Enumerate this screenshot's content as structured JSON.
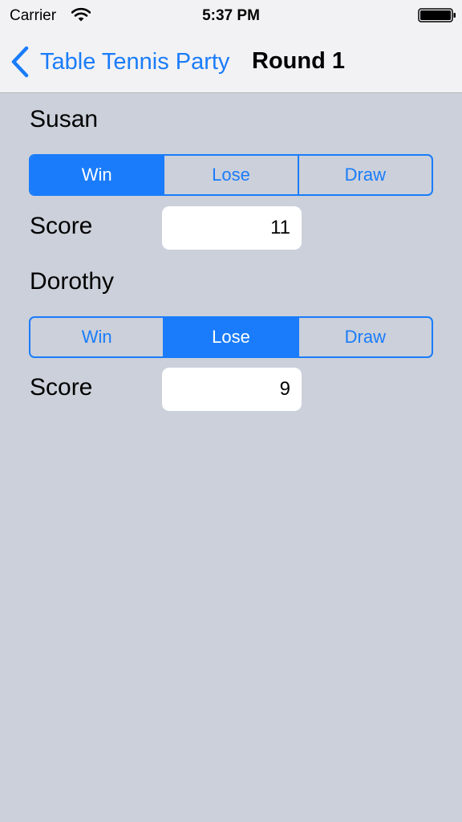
{
  "status_bar": {
    "carrier": "Carrier",
    "time": "5:37 PM",
    "wifi_icon": "wifi-icon",
    "battery_icon": "battery-full-icon"
  },
  "nav": {
    "back_label": "Table Tennis Party",
    "back_icon": "chevron-left-icon",
    "title": "Round 1"
  },
  "colors": {
    "accent": "#1a7cfa",
    "background": "#cbd0da",
    "nav_background": "#f2f2f4"
  },
  "players": [
    {
      "name": "Susan",
      "options": [
        "Win",
        "Lose",
        "Draw"
      ],
      "selected": "Win",
      "score_label": "Score",
      "score": "11"
    },
    {
      "name": "Dorothy",
      "options": [
        "Win",
        "Lose",
        "Draw"
      ],
      "selected": "Lose",
      "score_label": "Score",
      "score": "9"
    }
  ]
}
